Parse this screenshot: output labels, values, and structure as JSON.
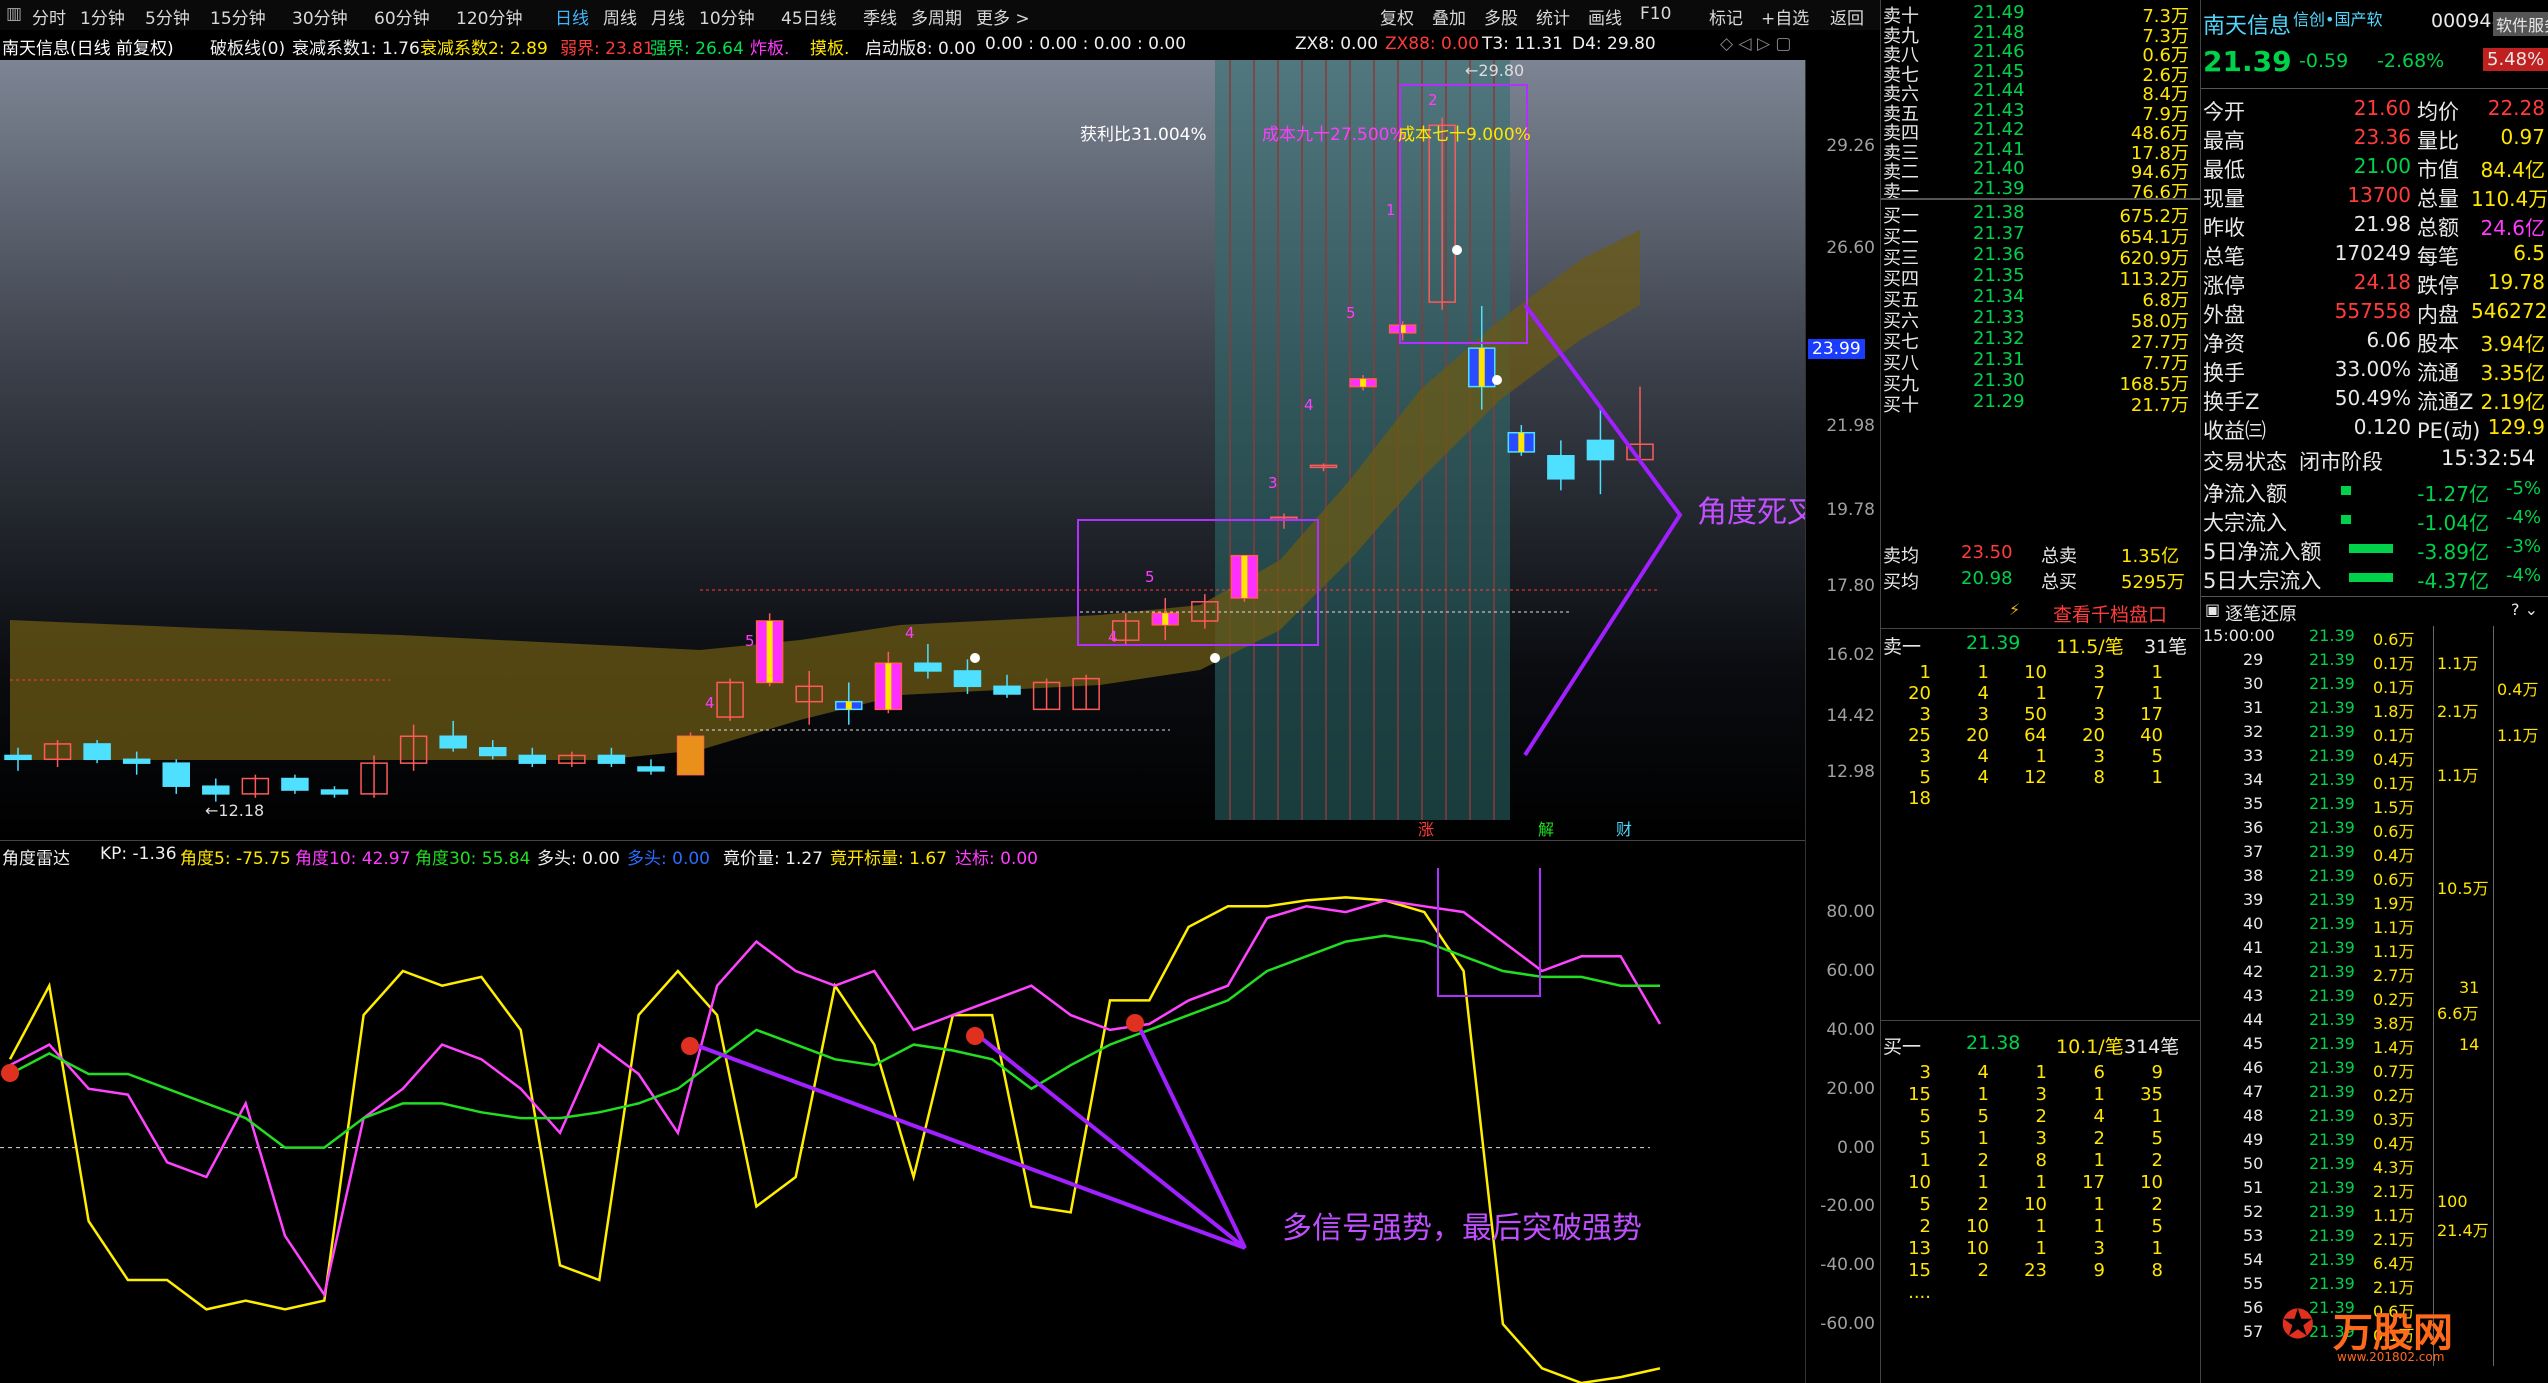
{
  "toolbar": {
    "periods": [
      "分时",
      "1分钟",
      "5分钟",
      "15分钟",
      "30分钟",
      "60分钟",
      "120分钟",
      "日线",
      "周线",
      "月线",
      "10分钟",
      "45日线",
      "季线",
      "多周期",
      "更多 >"
    ],
    "right_items": [
      "复权",
      "叠加",
      "多股",
      "统计",
      "画线",
      "F10",
      "标记",
      "+自选",
      "返回"
    ]
  },
  "info_bar": {
    "stock": "南天信息(日线 前复权)",
    "items": [
      "破板线(0)",
      "衰减系数1: 1.76",
      "衰减系数2: 2.89",
      "弱界: 23.81",
      "强界: 26.64",
      "炸板.",
      "摸板.",
      "启动版8: 0.00",
      "0.00 : 0.00 : 0.00 : 0.00",
      "ZX8: 0.00",
      "ZX88: 0.00",
      "T3: 11.31",
      "D4: 29.80"
    ]
  },
  "chart_data": [
    {
      "type": "candlestick",
      "title": "南天信息(日线 前复权)",
      "y_ticks": [
        29.26,
        26.6,
        23.99,
        21.98,
        19.78,
        17.8,
        16.02,
        14.42,
        12.98
      ],
      "price_marker": 23.99,
      "high_label": "29.80",
      "low_label": "12.18",
      "candles": [
        {
          "o": 13.4,
          "h": 13.6,
          "l": 13.0,
          "c": 13.3
        },
        {
          "o": 13.3,
          "h": 13.8,
          "l": 13.1,
          "c": 13.7
        },
        {
          "o": 13.7,
          "h": 13.8,
          "l": 13.2,
          "c": 13.3
        },
        {
          "o": 13.3,
          "h": 13.5,
          "l": 12.9,
          "c": 13.2
        },
        {
          "o": 13.2,
          "h": 13.3,
          "l": 12.4,
          "c": 12.6
        },
        {
          "o": 12.6,
          "h": 12.8,
          "l": 12.2,
          "c": 12.4
        },
        {
          "o": 12.4,
          "h": 12.9,
          "l": 12.3,
          "c": 12.8
        },
        {
          "o": 12.8,
          "h": 12.9,
          "l": 12.4,
          "c": 12.5
        },
        {
          "o": 12.5,
          "h": 12.6,
          "l": 12.3,
          "c": 12.4
        },
        {
          "o": 12.4,
          "h": 13.4,
          "l": 12.3,
          "c": 13.2
        },
        {
          "o": 13.2,
          "h": 14.2,
          "l": 13.0,
          "c": 13.9
        },
        {
          "o": 13.9,
          "h": 14.3,
          "l": 13.5,
          "c": 13.6
        },
        {
          "o": 13.6,
          "h": 13.8,
          "l": 13.3,
          "c": 13.4
        },
        {
          "o": 13.4,
          "h": 13.6,
          "l": 13.1,
          "c": 13.2
        },
        {
          "o": 13.2,
          "h": 13.5,
          "l": 13.1,
          "c": 13.4
        },
        {
          "o": 13.4,
          "h": 13.6,
          "l": 13.1,
          "c": 13.2
        },
        {
          "o": 13.1,
          "h": 13.3,
          "l": 12.9,
          "c": 13.0
        },
        {
          "o": 12.9,
          "h": 14.0,
          "l": 12.9,
          "c": 13.9
        },
        {
          "o": 14.4,
          "h": 15.4,
          "l": 14.3,
          "c": 15.3
        },
        {
          "o": 15.3,
          "h": 17.1,
          "l": 15.2,
          "c": 16.9
        },
        {
          "o": 14.8,
          "h": 15.6,
          "l": 14.2,
          "c": 15.2
        },
        {
          "o": 14.8,
          "h": 15.3,
          "l": 14.2,
          "c": 14.6
        },
        {
          "o": 14.6,
          "h": 16.1,
          "l": 14.5,
          "c": 15.8
        },
        {
          "o": 15.8,
          "h": 16.3,
          "l": 15.4,
          "c": 15.6
        },
        {
          "o": 15.6,
          "h": 15.9,
          "l": 15.0,
          "c": 15.2
        },
        {
          "o": 15.2,
          "h": 15.5,
          "l": 14.9,
          "c": 15.0
        },
        {
          "o": 14.6,
          "h": 15.4,
          "l": 14.6,
          "c": 15.3
        },
        {
          "o": 14.6,
          "h": 15.5,
          "l": 14.6,
          "c": 15.4
        },
        {
          "o": 16.4,
          "h": 17.1,
          "l": 16.3,
          "c": 16.9
        },
        {
          "o": 16.8,
          "h": 17.5,
          "l": 16.4,
          "c": 17.1
        },
        {
          "o": 16.9,
          "h": 17.6,
          "l": 16.7,
          "c": 17.4
        },
        {
          "o": 17.5,
          "h": 18.6,
          "l": 17.4,
          "c": 18.6
        },
        {
          "o": 19.6,
          "h": 19.7,
          "l": 19.3,
          "c": 19.6
        },
        {
          "o": 20.9,
          "h": 21.0,
          "l": 20.8,
          "c": 20.95
        },
        {
          "o": 23.0,
          "h": 23.3,
          "l": 22.9,
          "c": 23.2
        },
        {
          "o": 24.4,
          "h": 24.7,
          "l": 24.2,
          "c": 24.6
        },
        {
          "o": 25.2,
          "h": 30.0,
          "l": 25.0,
          "c": 29.8
        },
        {
          "o": 24.0,
          "h": 25.1,
          "l": 22.4,
          "c": 23.0
        },
        {
          "o": 21.8,
          "h": 22.0,
          "l": 21.2,
          "c": 21.3
        },
        {
          "o": 21.2,
          "h": 21.6,
          "l": 20.3,
          "c": 20.6
        },
        {
          "o": 21.6,
          "h": 22.5,
          "l": 20.2,
          "c": 21.1
        },
        {
          "o": 21.1,
          "h": 23.0,
          "l": 21.0,
          "c": 21.5
        }
      ],
      "annotations": [
        "获利比31.004%",
        "成本九十27.500%",
        "成本七十9.000%"
      ],
      "callout": "角度死叉，逃顶位置"
    },
    {
      "type": "line",
      "title": "角度雷达",
      "y_ticks": [
        80.0,
        60.0,
        40.0,
        20.0,
        0.0,
        -20.0,
        -40.0,
        -60.0
      ],
      "ylim": [
        -80,
        90
      ],
      "series": [
        {
          "name": "角度5",
          "color": "#ffee00",
          "values": [
            30,
            55,
            -25,
            -45,
            -45,
            -55,
            -52,
            -55,
            -52,
            45,
            60,
            55,
            58,
            40,
            -40,
            -45,
            45,
            60,
            45,
            -20,
            -10,
            55,
            35,
            -10,
            45,
            45,
            -20,
            -22,
            50,
            50,
            75,
            82,
            82,
            84,
            85,
            84,
            80,
            60,
            -60,
            -75,
            -80,
            -78,
            -75
          ]
        },
        {
          "name": "角度10",
          "color": "#ff44ff",
          "values": [
            28,
            35,
            20,
            18,
            -5,
            -10,
            15,
            -30,
            -50,
            10,
            20,
            35,
            30,
            20,
            5,
            35,
            25,
            5,
            55,
            70,
            60,
            55,
            60,
            40,
            45,
            50,
            55,
            45,
            40,
            42,
            50,
            55,
            78,
            82,
            80,
            84,
            82,
            80,
            70,
            60,
            65,
            65,
            42
          ]
        },
        {
          "name": "角度30",
          "color": "#22dd22",
          "values": [
            25,
            32,
            25,
            25,
            20,
            15,
            10,
            0,
            0,
            10,
            15,
            15,
            12,
            10,
            10,
            12,
            15,
            20,
            30,
            40,
            35,
            30,
            28,
            35,
            33,
            30,
            20,
            28,
            35,
            40,
            45,
            50,
            60,
            65,
            70,
            72,
            70,
            65,
            60,
            58,
            58,
            55,
            55
          ]
        }
      ],
      "callout": "多信号强势，最后突破强势"
    }
  ],
  "indicator_header": {
    "name": "角度雷达",
    "kp": "KP: -1.36",
    "a5": "角度5: -75.75",
    "a10": "角度10: 42.97",
    "a30": "角度30: 55.84",
    "duotou": "多头: 0.00",
    "jiaofu": "多头: 0.00",
    "jjl": "竟价量: 1.27",
    "jkbl": "竟开标量: 1.67",
    "db": "达标: 0.00"
  },
  "quote": {
    "name": "南天信息",
    "tags": "信创•国产软",
    "code": "000948",
    "software": "软件服务",
    "price": "21.39",
    "change": "-0.59",
    "pct": "-2.68%",
    "pct2": "5.48%",
    "asks": [
      [
        "卖十",
        "21.49",
        "7.3万"
      ],
      [
        "卖九",
        "21.48",
        "7.3万"
      ],
      [
        "卖八",
        "21.46",
        "0.6万"
      ],
      [
        "卖七",
        "21.45",
        "2.6万"
      ],
      [
        "卖六",
        "21.44",
        "8.4万"
      ],
      [
        "卖五",
        "21.43",
        "7.9万"
      ],
      [
        "卖四",
        "21.42",
        "48.6万"
      ],
      [
        "卖三",
        "21.41",
        "17.8万"
      ],
      [
        "卖二",
        "21.40",
        "94.6万"
      ],
      [
        "卖一",
        "21.39",
        "76.6万"
      ]
    ],
    "bids": [
      [
        "买一",
        "21.38",
        "675.2万"
      ],
      [
        "买二",
        "21.37",
        "654.1万"
      ],
      [
        "买三",
        "21.36",
        "620.9万"
      ],
      [
        "买四",
        "21.35",
        "113.2万"
      ],
      [
        "买五",
        "21.34",
        "6.8万"
      ],
      [
        "买六",
        "21.33",
        "58.0万"
      ],
      [
        "买七",
        "21.32",
        "27.7万"
      ],
      [
        "买八",
        "21.31",
        "7.7万"
      ],
      [
        "买九",
        "21.30",
        "168.5万"
      ],
      [
        "买十",
        "21.29",
        "21.7万"
      ]
    ],
    "avg_sell": [
      "卖均",
      "23.50",
      "总卖",
      "1.35亿"
    ],
    "avg_buy": [
      "买均",
      "20.98",
      "总买",
      "5295万"
    ],
    "stats": [
      [
        "今开",
        "21.60",
        "均价",
        "22.28"
      ],
      [
        "最高",
        "23.36",
        "量比",
        "0.97"
      ],
      [
        "最低",
        "21.00",
        "市值",
        "84.4亿"
      ],
      [
        "现量",
        "13700",
        "总量",
        "110.4万"
      ],
      [
        "昨收",
        "21.98",
        "总额",
        "24.6亿"
      ],
      [
        "总笔",
        "170249",
        "每笔",
        "6.5"
      ],
      [
        "涨停",
        "24.18",
        "跌停",
        "19.78"
      ],
      [
        "外盘",
        "557558",
        "内盘",
        "546272"
      ],
      [
        "净资",
        "6.06",
        "股本",
        "3.94亿"
      ],
      [
        "换手",
        "33.00%",
        "流通",
        "3.35亿"
      ],
      [
        "换手Z",
        "50.49%",
        "流通Z",
        "2.19亿"
      ],
      [
        "收益㈢",
        "0.120",
        "PE(动)",
        "129.9"
      ]
    ],
    "trade_state": [
      "交易状态",
      "闭市阶段",
      "15:32:54"
    ],
    "flows": [
      [
        "净流入额",
        "-1.27亿",
        "-5%"
      ],
      [
        "大宗流入",
        "-1.04亿",
        "-4%"
      ],
      [
        "5日净流入额",
        "-3.89亿",
        "-3%"
      ],
      [
        "5日大宗流入",
        "-4.37亿",
        "-4%"
      ]
    ],
    "view_btn": "查看千档盘口",
    "zhuobi": "逐笔还原",
    "sell1_hdr": [
      "卖一",
      "21.39",
      "11.5/笔",
      "31笔"
    ],
    "buy1_hdr": [
      "买一",
      "21.38",
      "10.1/笔",
      "314笔"
    ],
    "sell1_grid": [
      [
        1,
        1,
        10,
        3,
        1
      ],
      [
        20,
        4,
        1,
        7,
        1
      ],
      [
        3,
        3,
        50,
        3,
        17
      ],
      [
        25,
        20,
        64,
        20,
        40
      ],
      [
        3,
        4,
        1,
        3,
        5
      ],
      [
        5,
        4,
        12,
        8,
        1
      ],
      [
        18,
        "",
        "",
        "",
        ""
      ]
    ],
    "buy1_grid": [
      [
        3,
        4,
        1,
        6,
        9
      ],
      [
        15,
        1,
        3,
        1,
        35
      ],
      [
        5,
        5,
        2,
        4,
        1
      ],
      [
        5,
        1,
        3,
        2,
        5
      ],
      [
        1,
        2,
        8,
        1,
        2
      ],
      [
        10,
        1,
        1,
        17,
        10
      ],
      [
        5,
        2,
        10,
        1,
        2
      ],
      [
        2,
        10,
        1,
        1,
        5
      ],
      [
        13,
        10,
        1,
        3,
        1
      ],
      [
        15,
        2,
        23,
        9,
        8
      ],
      [
        "....",
        "",
        "",
        "",
        ""
      ]
    ],
    "ticks": [
      [
        "15:00:00",
        "21.39",
        "0.6万"
      ],
      [
        "29",
        "21.39",
        "0.1万"
      ],
      [
        "30",
        "21.39",
        "0.1万"
      ],
      [
        "31",
        "21.39",
        "1.8万"
      ],
      [
        "32",
        "21.39",
        "0.1万"
      ],
      [
        "33",
        "21.39",
        "0.4万"
      ],
      [
        "34",
        "21.39",
        "0.1万"
      ],
      [
        "35",
        "21.39",
        "1.5万"
      ],
      [
        "36",
        "21.39",
        "0.6万"
      ],
      [
        "37",
        "21.39",
        "0.4万"
      ],
      [
        "38",
        "21.39",
        "0.6万"
      ],
      [
        "39",
        "21.39",
        "1.9万"
      ],
      [
        "40",
        "21.39",
        "1.1万"
      ],
      [
        "41",
        "21.39",
        "1.1万"
      ],
      [
        "42",
        "21.39",
        "2.7万"
      ],
      [
        "43",
        "21.39",
        "0.2万"
      ],
      [
        "44",
        "21.39",
        "3.8万"
      ],
      [
        "45",
        "21.39",
        "1.4万"
      ],
      [
        "46",
        "21.39",
        "0.7万"
      ],
      [
        "47",
        "21.39",
        "0.2万"
      ],
      [
        "48",
        "21.39",
        "0.3万"
      ],
      [
        "49",
        "21.39",
        "0.4万"
      ],
      [
        "50",
        "21.39",
        "4.3万"
      ],
      [
        "51",
        "21.39",
        "2.1万"
      ],
      [
        "52",
        "21.39",
        "1.1万"
      ],
      [
        "53",
        "21.39",
        "2.1万"
      ],
      [
        "54",
        "21.39",
        "6.4万"
      ],
      [
        "55",
        "21.39",
        "2.1万"
      ],
      [
        "56",
        "21.39",
        "0.6万"
      ],
      [
        "57",
        "21.39",
        "0.1万"
      ]
    ],
    "tick_bars": [
      "1.1万",
      "2.1万",
      "1.1万",
      "10.5万",
      "31",
      "6.6万",
      "14",
      "100",
      "21.4万"
    ],
    "tick_side": [
      "0.4万",
      "1.1万"
    ]
  },
  "watermark": "万股网",
  "watermark_url": "www.201802.com",
  "badges": {
    "zhang": "涨",
    "jie": "解",
    "cai": "财"
  }
}
